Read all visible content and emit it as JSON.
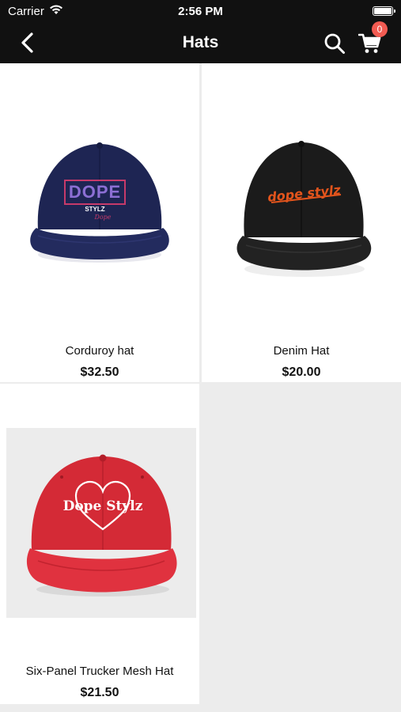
{
  "status_bar": {
    "carrier": "Carrier",
    "time": "2:56 PM"
  },
  "nav": {
    "title": "Hats",
    "cart_count": "0"
  },
  "products": [
    {
      "name": "Corduroy hat",
      "price": "$32.50",
      "hat_color": "#1e2553",
      "logo_text": "DOPE",
      "logo_sub": "STYLZ"
    },
    {
      "name": "Denim Hat",
      "price": "$20.00",
      "hat_color": "#1b1b1b",
      "logo_text": "dope stylz"
    },
    {
      "name": "Six-Panel Trucker Mesh Hat",
      "price": "$21.50",
      "hat_color": "#d42a36",
      "logo_text": "Dope Stylz"
    }
  ],
  "colors": {
    "bar": "#111111",
    "badge": "#f25b52",
    "background": "#ececec"
  }
}
